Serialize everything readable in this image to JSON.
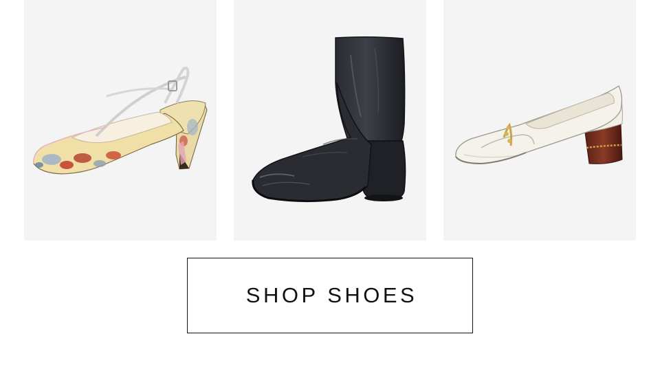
{
  "products": [
    {
      "name": "floral-slingback-t-strap-heel",
      "icon": "floral-pump-image"
    },
    {
      "name": "black-leather-ankle-boot",
      "icon": "black-boot-image"
    },
    {
      "name": "white-leather-horsebit-loafer-pump",
      "icon": "white-loafer-image"
    }
  ],
  "cta": {
    "label": "SHOP SHOES"
  },
  "colors": {
    "tile_background": "#f4f4f4",
    "text": "#111111",
    "border": "#111111"
  }
}
